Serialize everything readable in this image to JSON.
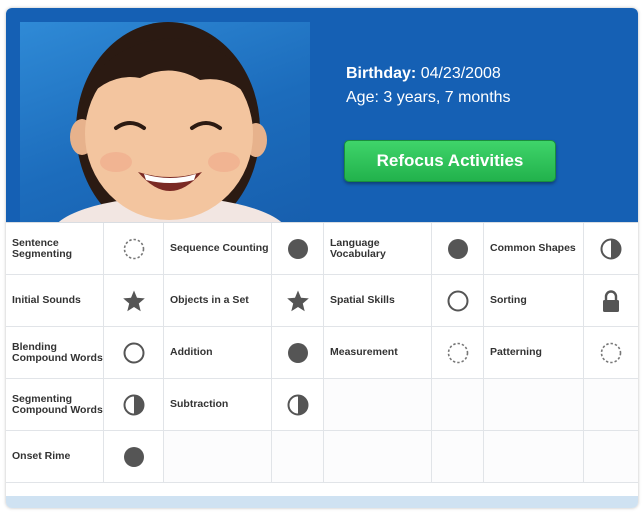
{
  "profile": {
    "birthday_label": "Birthday:",
    "birthday_value": "04/23/2008",
    "age_text": "Age: 3 years, 7 months",
    "refocus_label": "Refocus Activities"
  },
  "colors": {
    "header_blue": "#1560b4",
    "button_green": "#2bc255",
    "icon_gray": "#555555"
  },
  "skills": [
    [
      {
        "label": "Sentence Segmenting",
        "status": "dashed-circle-icon"
      },
      {
        "label": "Sequence Counting",
        "status": "filled-circle-icon"
      },
      {
        "label": "Language Vocabulary",
        "status": "filled-circle-icon"
      },
      {
        "label": "Common Shapes",
        "status": "half-circle-icon"
      }
    ],
    [
      {
        "label": "Initial Sounds",
        "status": "star-icon"
      },
      {
        "label": "Objects in a Set",
        "status": "star-icon"
      },
      {
        "label": "Spatial Skills",
        "status": "empty-circle-icon"
      },
      {
        "label": "Sorting",
        "status": "lock-icon"
      }
    ],
    [
      {
        "label": "Blending Compound Words",
        "status": "empty-circle-icon"
      },
      {
        "label": "Addition",
        "status": "filled-circle-icon"
      },
      {
        "label": "Measurement",
        "status": "dashed-circle-icon"
      },
      {
        "label": "Patterning",
        "status": "dashed-circle-icon"
      }
    ],
    [
      {
        "label": "Segmenting Compound Words",
        "status": "half-circle-icon"
      },
      {
        "label": "Subtraction",
        "status": "half-circle-icon"
      },
      null,
      null
    ],
    [
      {
        "label": "Onset Rime",
        "status": "filled-circle-icon"
      },
      null,
      null,
      null
    ]
  ]
}
